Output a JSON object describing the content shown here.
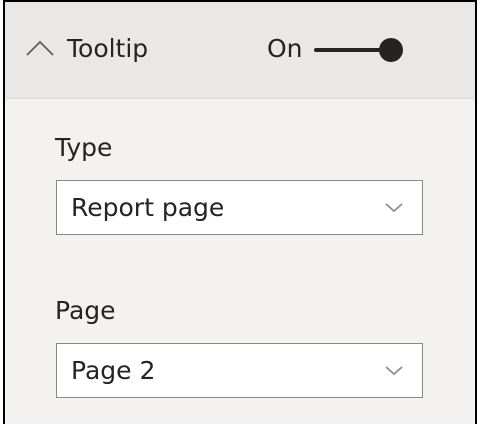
{
  "section": {
    "title": "Tooltip",
    "toggle_label": "On",
    "toggle_state": "on"
  },
  "fields": {
    "type": {
      "label": "Type",
      "value": "Report page"
    },
    "page": {
      "label": "Page",
      "value": "Page 2"
    }
  },
  "icons": {
    "collapse": "chevron-up-icon",
    "dropdown": "chevron-down-icon"
  },
  "colors": {
    "text": "#252423",
    "panel_bg": "#f3f2f1",
    "header_bg": "#e9e8e7",
    "field_border": "#8a8886",
    "toggle_on": "#252423"
  }
}
